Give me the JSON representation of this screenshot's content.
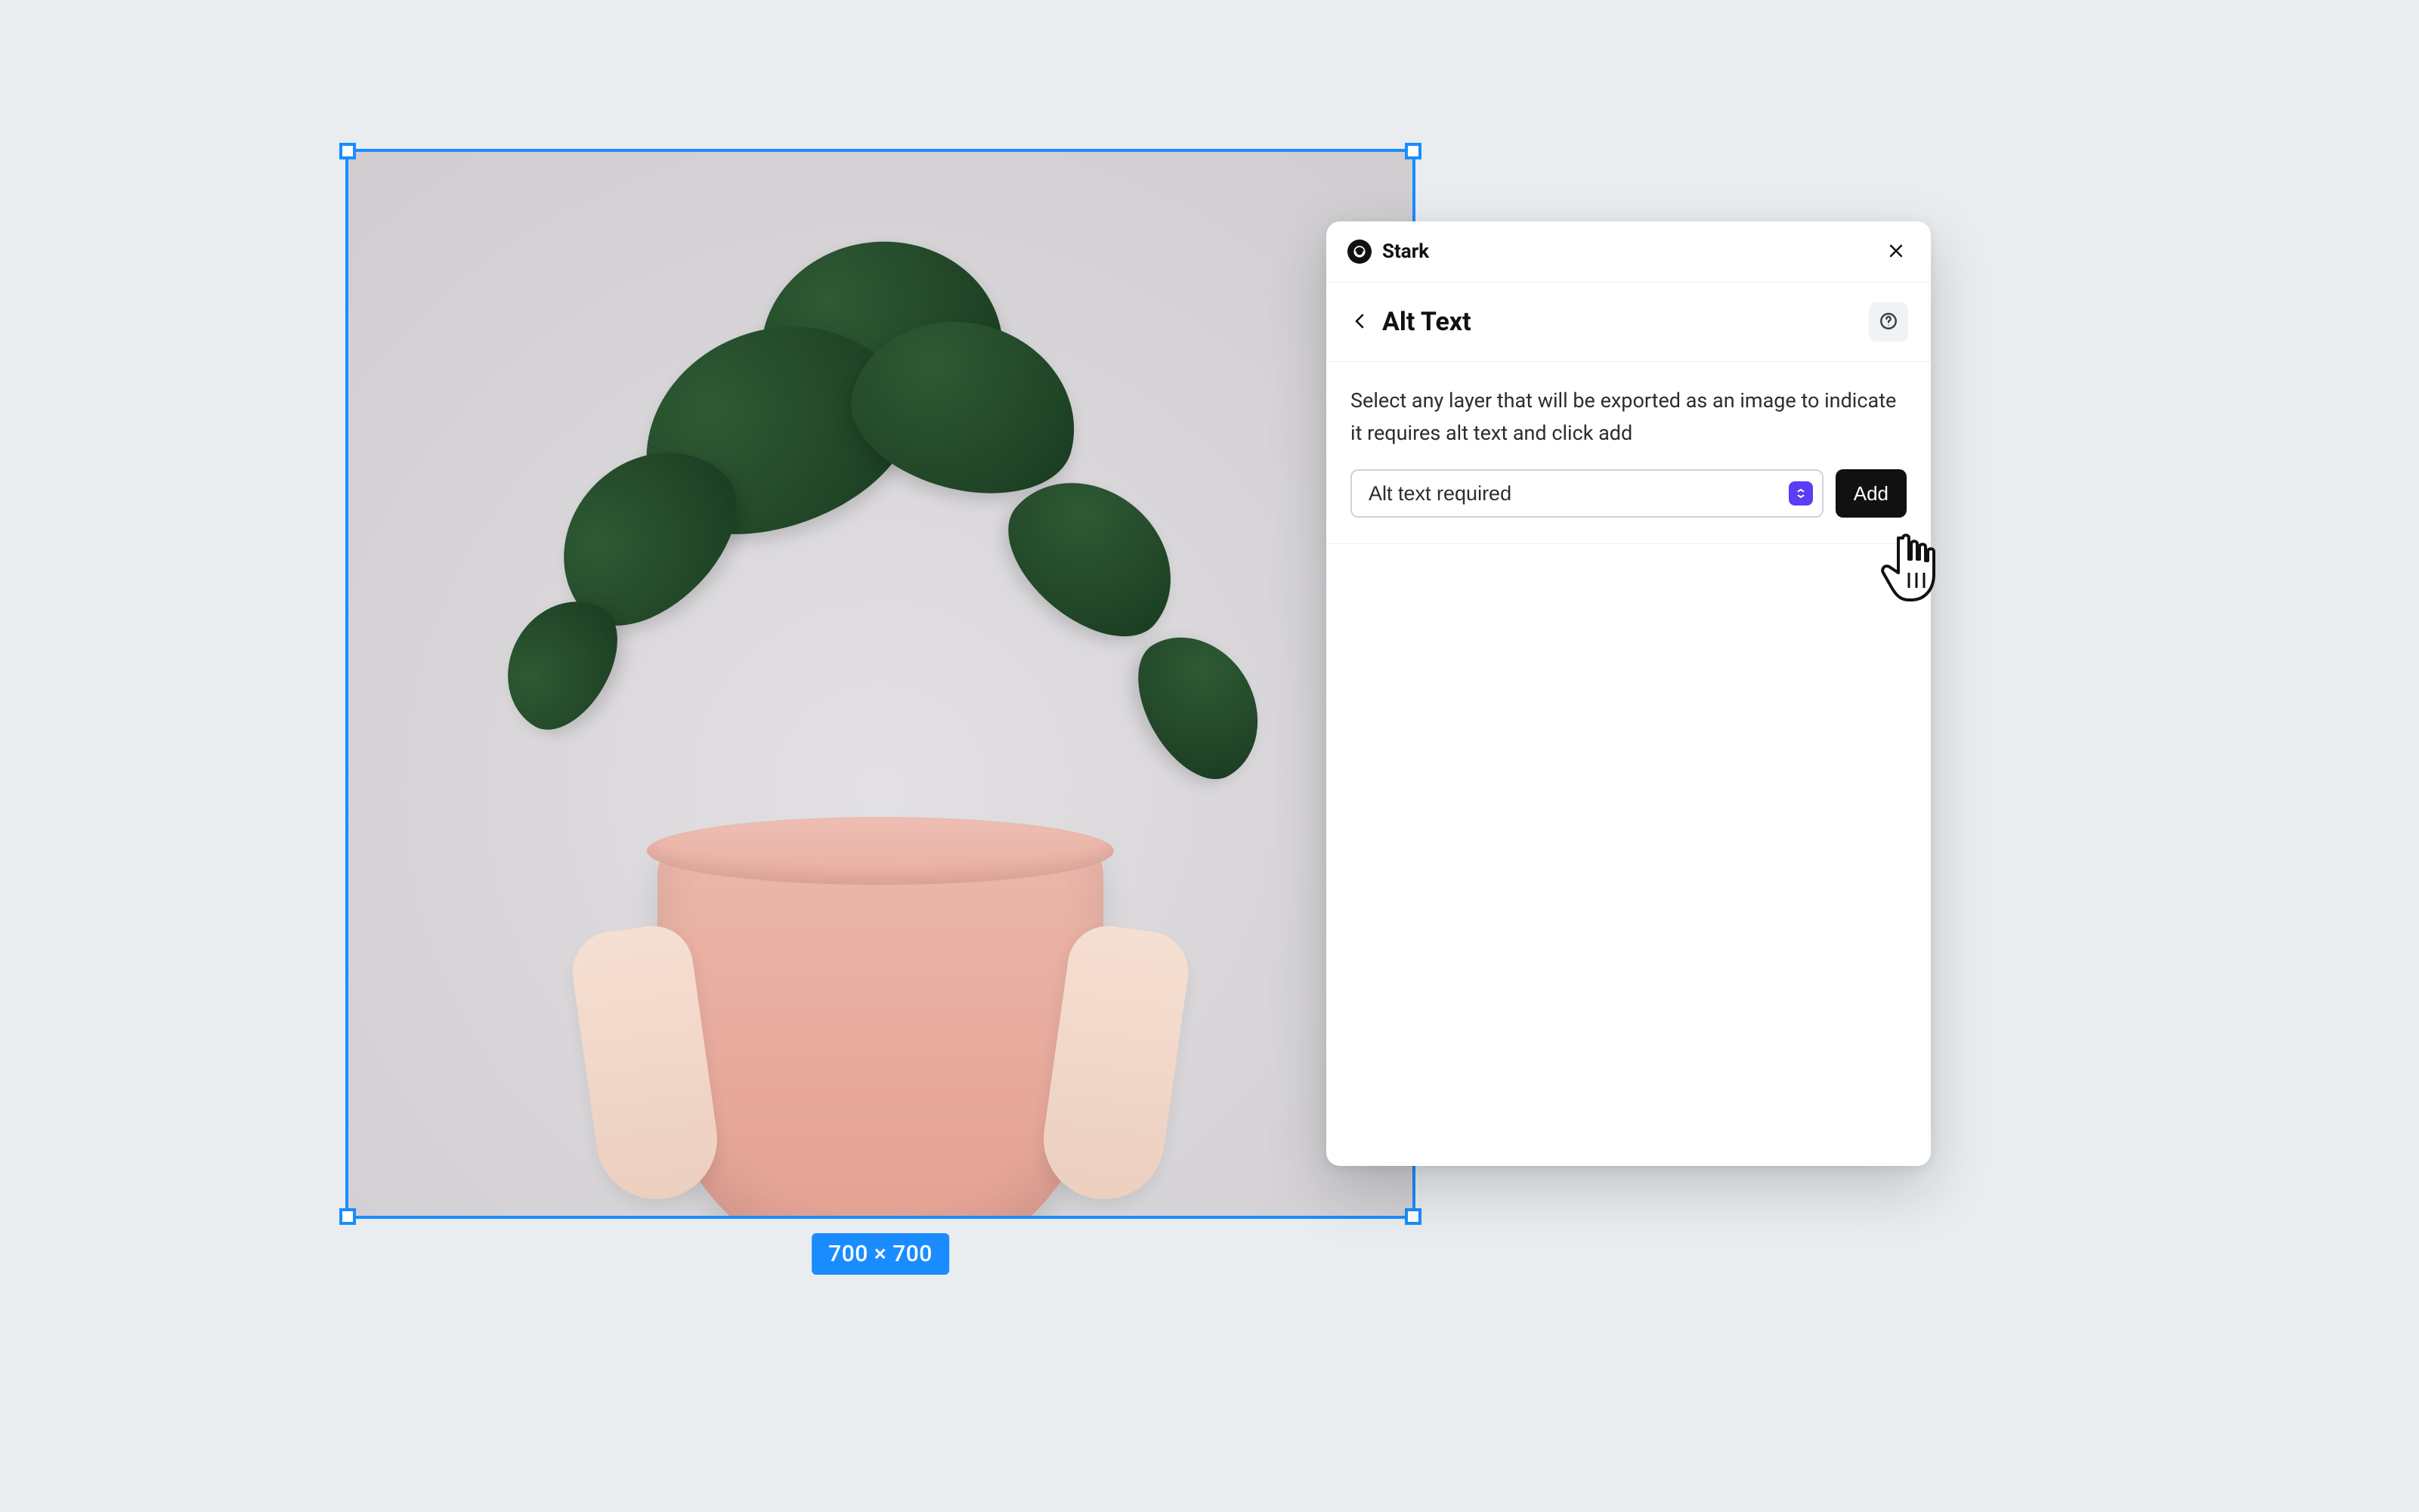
{
  "canvas": {
    "selection_dimensions": "700 × 700",
    "image_description": "Hands holding a pink pot with a green plant"
  },
  "panel": {
    "brand_name": "Stark",
    "section_title": "Alt Text",
    "instructions": "Select any layer that will be exported as an image to indicate it requires alt text and click add",
    "select_value": "Alt text required",
    "add_button": "Add"
  },
  "colors": {
    "selection_blue": "#1a8cff",
    "accent_purple": "#5b3df5",
    "panel_bg": "#ffffff",
    "stage_bg": "#e9edf0"
  }
}
